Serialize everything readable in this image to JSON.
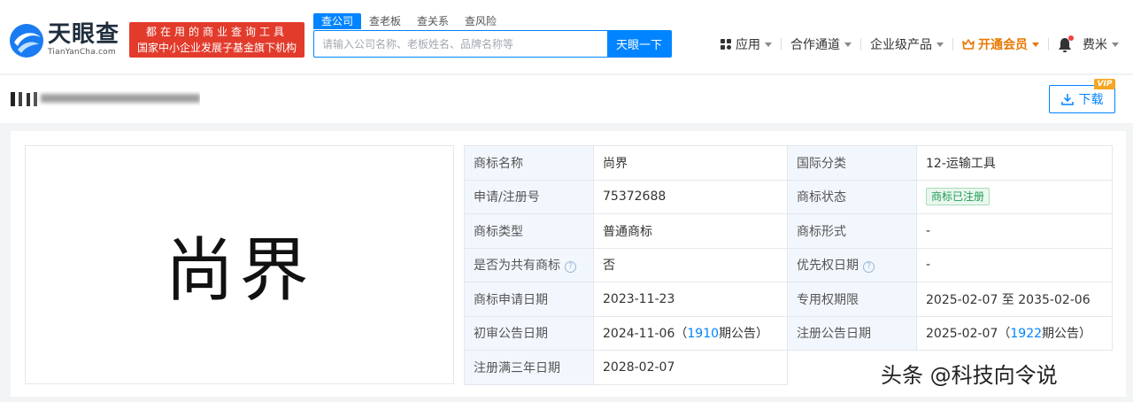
{
  "header": {
    "logo_text": "天眼查",
    "logo_sub": "TianYanCha.com",
    "slogan_line1": "都在用的商业查询工具",
    "slogan_line2": "国家中小企业发展子基金旗下机构",
    "search_tabs": [
      "查公司",
      "查老板",
      "查关系",
      "查风险"
    ],
    "search_placeholder": "请输入公司名称、老板姓名、品牌名称等",
    "search_button": "天眼一下",
    "nav": {
      "apps": "应用",
      "channel": "合作通道",
      "enterprise": "企业级产品",
      "vip": "开通会员",
      "user": "费米"
    }
  },
  "company_bar": {
    "download_label": "下载",
    "vip_tag": "VIP"
  },
  "trademark": {
    "image_text": "尚界",
    "rows": [
      {
        "k1": "商标名称",
        "v1": "尚界",
        "k2": "国际分类",
        "v2": "12-运输工具"
      },
      {
        "k1": "申请/注册号",
        "v1": "75372688",
        "k2": "商标状态",
        "v2": "商标已注册"
      },
      {
        "k1": "商标类型",
        "v1": "普通商标",
        "k2": "商标形式",
        "v2": "-"
      },
      {
        "k1": "是否为共有商标",
        "v1": "否",
        "k2": "优先权日期",
        "v2": "-"
      },
      {
        "k1": "商标申请日期",
        "v1": "2023-11-23",
        "k2": "专用权期限",
        "v2": "2025-02-07 至 2035-02-06"
      },
      {
        "k1": "初审公告日期",
        "v1_date": "2024-11-06（",
        "v1_issue": "1910",
        "v1_suffix": "期公告）",
        "k2": "注册公告日期",
        "v2_date": "2025-02-07（",
        "v2_issue": "1922",
        "v2_suffix": "期公告）"
      },
      {
        "k1": "注册满三年日期",
        "v1": "2028-02-07"
      }
    ]
  },
  "watermark": "头条 @科技向令说",
  "colors": {
    "primary": "#0084ff",
    "slogan_bg": "#e23b2c",
    "vip": "#e87700",
    "label_bg": "#f2f7fd",
    "status_green": "#1f9d55"
  }
}
